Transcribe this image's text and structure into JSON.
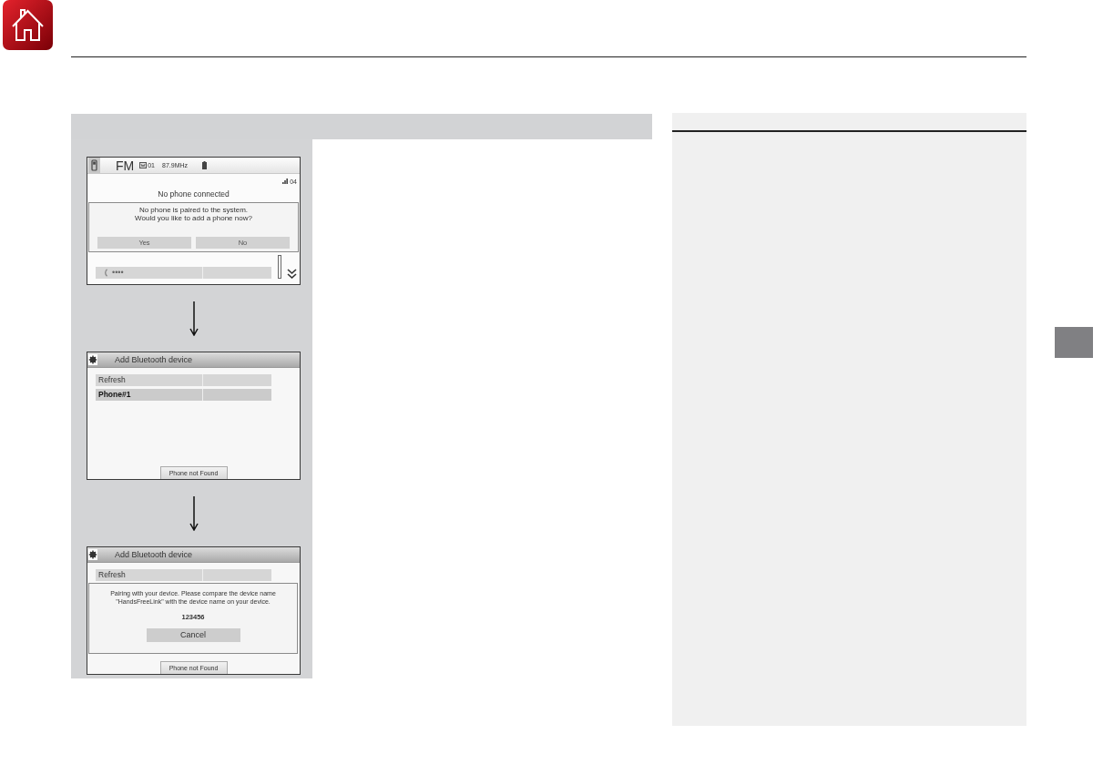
{
  "screens": [
    {
      "kind": "audio",
      "top_bar": {
        "source": "FM",
        "preset": "01",
        "frequency": "87.9MHz"
      },
      "indicator": "04",
      "status": "No phone connected",
      "list": [
        {
          "label": "••••",
          "selected": false
        }
      ],
      "dialog": {
        "lines": [
          "No phone is paired to the system.",
          "Would you like to add a phone now?"
        ],
        "buttons": [
          "Yes",
          "No"
        ]
      }
    },
    {
      "kind": "settings",
      "title": "Add Bluetooth device",
      "list": [
        {
          "label": "Refresh",
          "selected": false
        },
        {
          "label": "Phone#1",
          "selected": true
        }
      ],
      "footer_button": "Phone not Found"
    },
    {
      "kind": "settings",
      "title": "Add Bluetooth device",
      "list": [
        {
          "label": "Refresh",
          "selected": false
        }
      ],
      "dialog": {
        "lines": [
          "Pairing with your device. Please compare the device name",
          "\"HandsFreeLink\" with the device name on your device."
        ],
        "code": "123456",
        "buttons": [
          "Cancel"
        ]
      },
      "footer_button": "Phone not Found"
    }
  ]
}
